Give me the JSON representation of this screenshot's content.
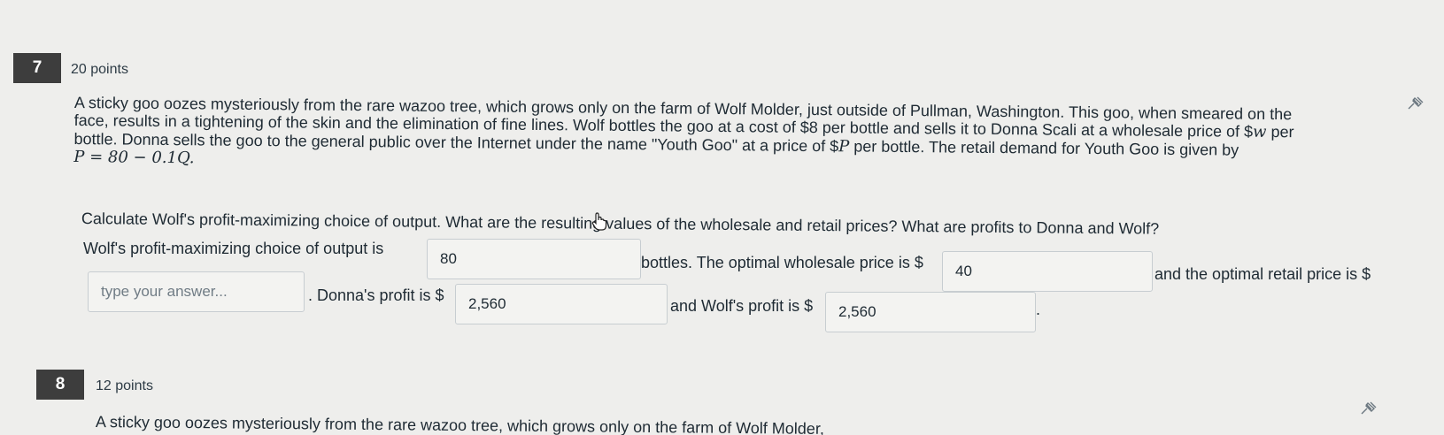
{
  "q7": {
    "number": "7",
    "points": "20 points",
    "intro_line1": "A sticky goo oozes mysteriously from the rare wazoo tree, which grows only on the farm of Wolf Molder, just outside of Pullman, Washington. This goo, when smeared on the",
    "intro_line2": "face, results in a tightening of the skin and the elimination of fine lines. Wolf bottles the goo at a cost of $8 per bottle and sells it to Donna Scali at a wholesale price of $",
    "intro_w": "w",
    "intro_line2b": " per",
    "intro_line3": "bottle. Donna sells the goo to the general public over the Internet under the name \"Youth Goo\" at a price of $",
    "intro_P": "P",
    "intro_line3b": " per bottle. The retail demand for Youth Goo is given by",
    "intro_formula": "P = 80 − 0.1Q.",
    "ask": "Calculate Wolf's profit-maximizing choice of output. What are the resulting values of the wholesale and retail prices? What are profits to Donna and Wolf?",
    "label_output": "Wolf's profit-maximizing choice of output is",
    "value_output": "80",
    "label_wholesale": "bottles. The optimal wholesale price is $",
    "value_wholesale": "40",
    "label_retail": "and the optimal retail price is $",
    "placeholder_retail": "type your answer...",
    "label_donna": ". Donna's profit is $",
    "value_donna": "2,560",
    "label_wolf": "and Wolf's profit is $",
    "value_wolf": "2,560",
    "end_period": "."
  },
  "q8": {
    "number": "8",
    "points": "12 points",
    "intro_partial": "A sticky goo oozes mysteriously from the rare wazoo tree, which grows only on the farm of Wolf Molder,"
  },
  "icons": {
    "pin": "pin-icon",
    "cursor": "hand-cursor-icon"
  }
}
